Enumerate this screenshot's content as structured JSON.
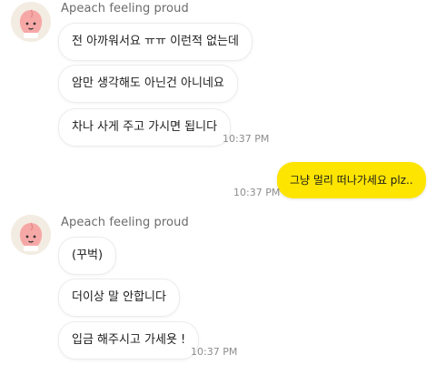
{
  "threads": [
    {
      "sender": "Apeach feeling proud",
      "messages": [
        "전 아까워서요 ㅠㅠ 이런적 없는데",
        "암만 생각해도 아닌건 아니네요",
        "차나 사게 주고 가시면 됩니다"
      ],
      "time": "10:37 PM"
    },
    {
      "sender": "Apeach feeling proud",
      "messages": [
        "(꾸벅)",
        "더이상 말 안합니다",
        "입금 해주시고 가세욧 !"
      ],
      "time": "10:37 PM"
    }
  ],
  "my_message": {
    "text": "그냥 멀리 떠나가세요 plz..",
    "time": "10:37 PM"
  },
  "colors": {
    "my_bubble": "#fee500",
    "avatar_face": "#f6a8a6",
    "avatar_bg": "#f3ece2"
  },
  "icons": {
    "avatar": "apeach-avatar-icon"
  }
}
